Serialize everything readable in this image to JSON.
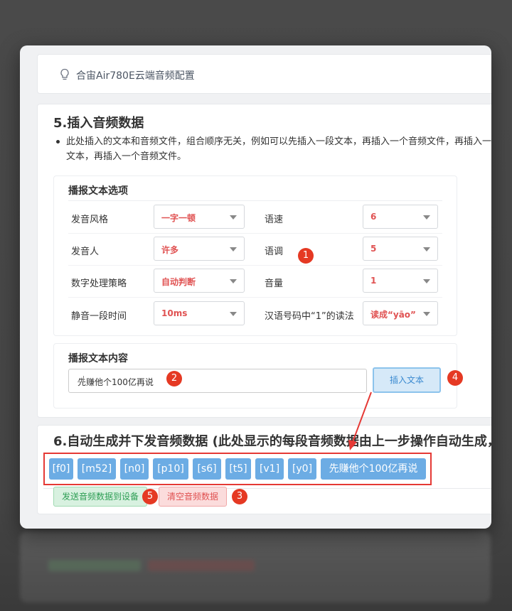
{
  "header": {
    "title": "合宙Air780E云端音频配置"
  },
  "section5": {
    "heading": "5.插入音频数据",
    "description": "此处插入的文本和音频文件，组合顺序无关，例如可以先插入一段文本，再插入一个音频文件，再插入一段文本，再插入一个音频文件。",
    "options_title": "播报文本选项",
    "options": [
      {
        "label": "发音风格",
        "value": "一字一顿"
      },
      {
        "label": "语速",
        "value": "6"
      },
      {
        "label": "发音人",
        "value": "许多"
      },
      {
        "label": "语调",
        "value": "5"
      },
      {
        "label": "数字处理策略",
        "value": "自动判断"
      },
      {
        "label": "音量",
        "value": "1"
      },
      {
        "label": "静音一段时间",
        "value": "10ms"
      },
      {
        "label": "汉语号码中“1”的读法",
        "value": "读成“yāo”"
      }
    ],
    "text_title": "播报文本内容",
    "text_value": "先赚他个100亿再说",
    "insert_label": "插入文本"
  },
  "section6": {
    "heading": "6.自动生成并下发音频数据 (此处显示的每段音频数据由上一步操作自动生成，",
    "chips": [
      "[f0]",
      "[m52]",
      "[n0]",
      "[p10]",
      "[s6]",
      "[t5]",
      "[v1]",
      "[y0]",
      "先赚他个100亿再说"
    ],
    "send_label": "发送音频数据到设备",
    "clear_label": "清空音频数据"
  },
  "badges": [
    "1",
    "2",
    "3",
    "4",
    "5"
  ],
  "colors": {
    "accent_red": "#e53935",
    "chip_blue": "#6cace4",
    "value_red": "#e05252"
  }
}
